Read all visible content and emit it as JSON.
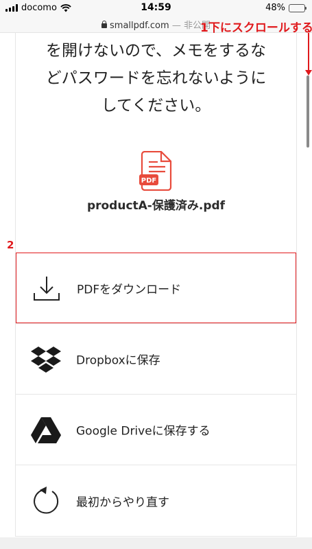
{
  "status_bar": {
    "carrier": "docomo",
    "time": "14:59",
    "battery": "48%",
    "battery_level": 0.48
  },
  "url_bar": {
    "domain": "smallpdf.com",
    "separator": "—",
    "suffix": "非公開"
  },
  "annotations": {
    "step1": "1下にスクロールする",
    "step2": "2"
  },
  "main": {
    "message_lines": [
      "を開けないので、メモをするな",
      "どパスワードを忘れないように",
      "してください。"
    ],
    "file_icon_label": "PDF",
    "filename": "productA-保護済み.pdf"
  },
  "options": [
    {
      "label": "PDFをダウンロード",
      "icon": "download-icon"
    },
    {
      "label": "Dropboxに保存",
      "icon": "dropbox-icon"
    },
    {
      "label": "Google Driveに保存する",
      "icon": "google-drive-icon"
    },
    {
      "label": "最初からやり直す",
      "icon": "restart-icon"
    }
  ],
  "colors": {
    "annotation_red": "#e0191c",
    "pdf_red": "#e84b3c",
    "battery_green": "#3fc14b"
  }
}
